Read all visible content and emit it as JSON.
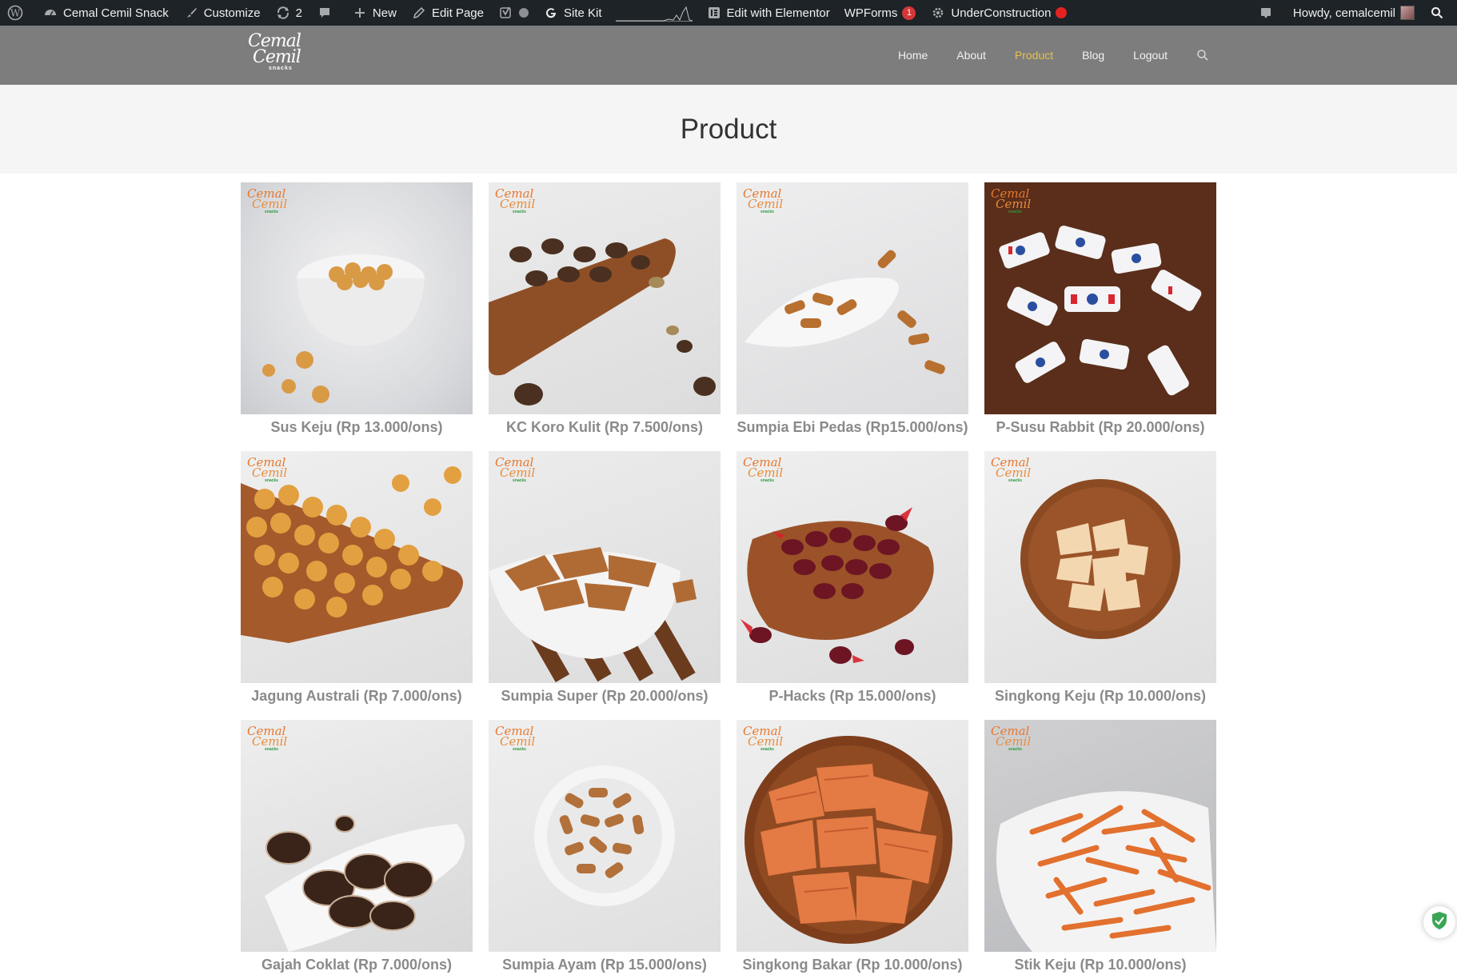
{
  "admin_bar": {
    "site_name": "Cemal Cemil Snack",
    "customize": "Customize",
    "updates_count": "2",
    "new": "New",
    "edit_page": "Edit Page",
    "site_kit": "Site Kit",
    "edit_with_elementor": "Edit with Elementor",
    "wpforms": "WPForms",
    "wpforms_count": "1",
    "under_construction": "UnderConstruction",
    "howdy": "Howdy, cemalcemil"
  },
  "header": {
    "logo": {
      "line1": "Cemal",
      "line2": "Cemil",
      "line3": "snacks"
    },
    "nav": [
      "Home",
      "About",
      "Product",
      "Blog",
      "Logout"
    ],
    "active_nav": "Product"
  },
  "page_title": "Product",
  "products": [
    {
      "name": "Sus Keju (Rp 13.000/ons)"
    },
    {
      "name": "KC Koro Kulit (Rp 7.500/ons)"
    },
    {
      "name": "Sumpia Ebi Pedas (Rp15.000/ons)"
    },
    {
      "name": "P-Susu Rabbit (Rp 20.000/ons)"
    },
    {
      "name": "Jagung Australi (Rp 7.000/ons)"
    },
    {
      "name": "Sumpia Super (Rp 20.000/ons)"
    },
    {
      "name": "P-Hacks (Rp 15.000/ons)"
    },
    {
      "name": "Singkong Keju (Rp 10.000/ons)"
    },
    {
      "name": "Gajah Coklat (Rp 7.000/ons)"
    },
    {
      "name": "Sumpia Ayam (Rp 15.000/ons)"
    },
    {
      "name": "Singkong Bakar (Rp 10.000/ons)"
    },
    {
      "name": "Stik Keju (Rp 10.000/ons)"
    }
  ],
  "watermark": {
    "line1": "Cemal",
    "line2": "Cemil",
    "line3": "snacks"
  },
  "colors": {
    "admin_bar": "#1d2327",
    "header": "#7d7d7d",
    "active_nav": "#e8c14a",
    "caption": "#8a8a8a"
  }
}
